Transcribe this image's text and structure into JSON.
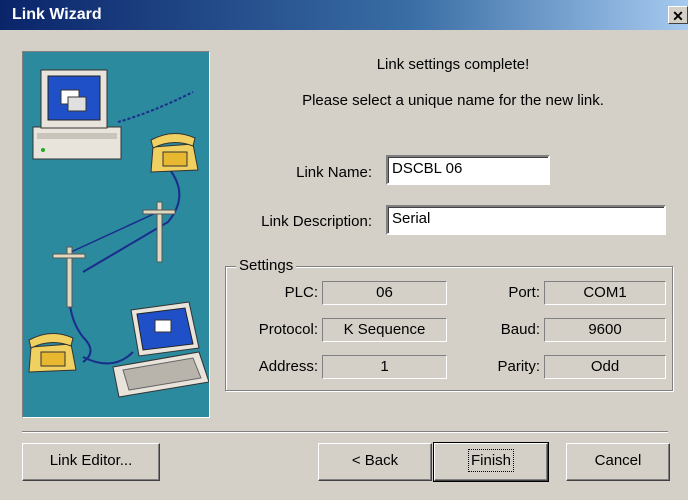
{
  "window": {
    "title": "Link Wizard",
    "close_glyph": "✕"
  },
  "message": {
    "line1": "Link settings complete!",
    "line2": "Please select a unique name for the new link."
  },
  "link_name": {
    "label": "Link Name:",
    "value": "DSCBL 06"
  },
  "link_description": {
    "label": "Link Description:",
    "value": "Serial"
  },
  "settings": {
    "title": "Settings",
    "plc": {
      "label": "PLC:",
      "value": "06"
    },
    "protocol": {
      "label": "Protocol:",
      "value": "K Sequence"
    },
    "address": {
      "label": "Address:",
      "value": "1"
    },
    "port": {
      "label": "Port:",
      "value": "COM1"
    },
    "baud": {
      "label": "Baud:",
      "value": "9600"
    },
    "parity": {
      "label": "Parity:",
      "value": "Odd"
    }
  },
  "buttons": {
    "link_editor": "Link Editor...",
    "back": "< Back",
    "finish": "Finish",
    "cancel": "Cancel"
  },
  "colors": {
    "illustration_bg": "#2b8a9d",
    "titlebar": "#0a246a"
  },
  "icons": [
    "computer-icon",
    "telephone-icon",
    "utility-pole-icon",
    "laptop-icon",
    "close-icon"
  ]
}
